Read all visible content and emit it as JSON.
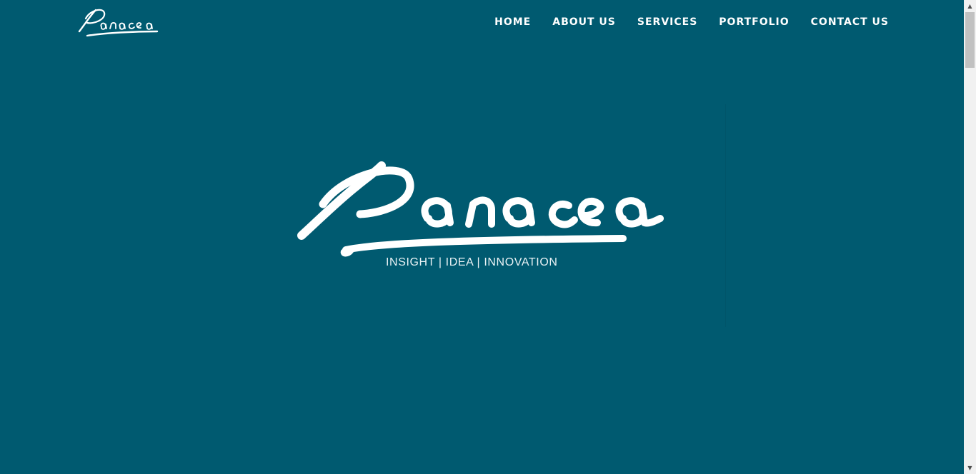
{
  "brand": {
    "name": "Panacea",
    "logo_color": "#ffffff"
  },
  "nav": {
    "items": [
      {
        "label": "HOME"
      },
      {
        "label": "ABOUT US"
      },
      {
        "label": "SERVICES"
      },
      {
        "label": "PORTFOLIO"
      },
      {
        "label": "CONTACT US"
      }
    ]
  },
  "hero": {
    "tagline": "INSIGHT  |  IDEA  |  INNOVATION"
  },
  "theme": {
    "background": "#005a70",
    "text": "#ffffff"
  },
  "scrollbar": {
    "up_glyph": "▲",
    "down_glyph": "▼"
  }
}
